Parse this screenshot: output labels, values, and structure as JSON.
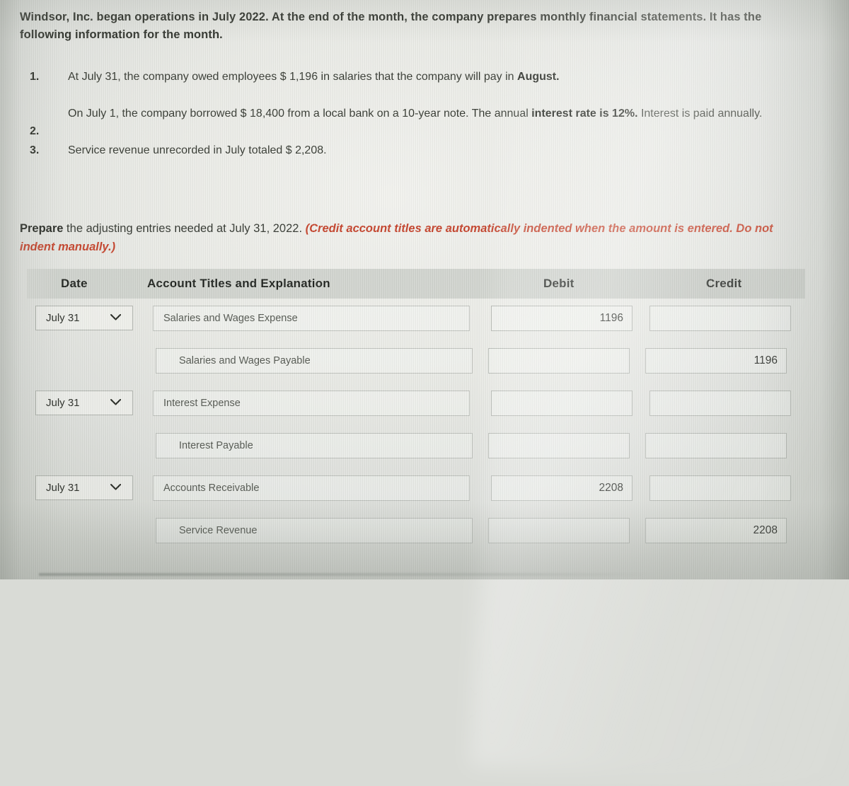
{
  "intro": {
    "line1_bold_a": "Windsor, Inc. began operations in July 2022. At the end of the month, the company prepares monthly financial statements. It has the",
    "line2": "following information for the month."
  },
  "items": [
    {
      "number": "1.",
      "text_plain_a": "At July 31, the company owed employees $ 1,196 in salaries that the company will pay in ",
      "text_bold": "August."
    },
    {
      "number": "2.",
      "text_plain_a": "On July 1, the company borrowed $ 18,400 from a local bank on a 10-year note. The annual ",
      "text_bold": "interest rate is  12%.",
      "text_plain_b": " Interest is paid annually."
    },
    {
      "number": "3.",
      "text_plain_a": "Service revenue unrecorded in July totaled $ 2,208.",
      "text_bold": "",
      "text_plain_b": ""
    }
  ],
  "prompt": {
    "bold_lead": "Prepare",
    "normal_mid": " the adjusting entries needed at July 31, 2022. ",
    "red_italic": "(Credit account titles are automatically indented when the amount is entered. Do not indent manually.)"
  },
  "journal": {
    "headers": {
      "date": "Date",
      "account": "Account Titles and Explanation",
      "debit": "Debit",
      "credit": "Credit"
    },
    "rows": [
      {
        "date": "July 31",
        "has_date_select": true,
        "account": "Salaries and Wages Expense",
        "indent": false,
        "debit": "1196",
        "credit": ""
      },
      {
        "date": "",
        "has_date_select": false,
        "account": "Salaries and Wages Payable",
        "indent": true,
        "debit": "",
        "credit": "1196"
      },
      {
        "date": "July 31",
        "has_date_select": true,
        "account": "Interest Expense",
        "indent": false,
        "debit": "",
        "credit": ""
      },
      {
        "date": "",
        "has_date_select": false,
        "account": "Interest Payable",
        "indent": true,
        "debit": "",
        "credit": ""
      },
      {
        "date": "July 31",
        "has_date_select": true,
        "account": "Accounts Receivable",
        "indent": false,
        "debit": "2208",
        "credit": ""
      },
      {
        "date": "",
        "has_date_select": false,
        "account": "Service Revenue",
        "indent": true,
        "debit": "",
        "credit": "2208"
      }
    ]
  },
  "colors": {
    "red_instruction": "#c23a22",
    "header_band": "#c4c8c2",
    "text": "#1f2220"
  }
}
